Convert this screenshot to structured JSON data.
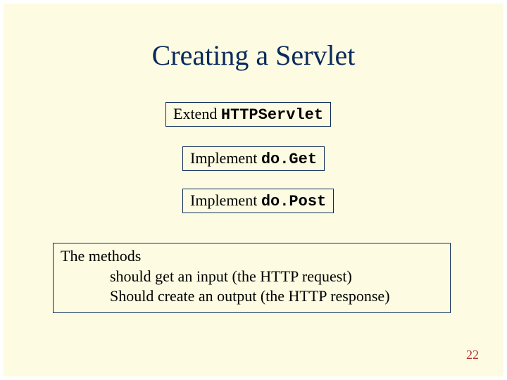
{
  "title": "Creating a Servlet",
  "boxes": {
    "extend": {
      "prefix": "Extend ",
      "code": "HTTPServlet"
    },
    "doGet": {
      "prefix": "Implement ",
      "code": "do.Get"
    },
    "doPost": {
      "prefix": "Implement ",
      "code": "do.Post"
    }
  },
  "methods": {
    "line1": "The methods",
    "line2": "should get an input (the HTTP request)",
    "line3": "Should create an output (the HTTP response)"
  },
  "page_number": "22"
}
